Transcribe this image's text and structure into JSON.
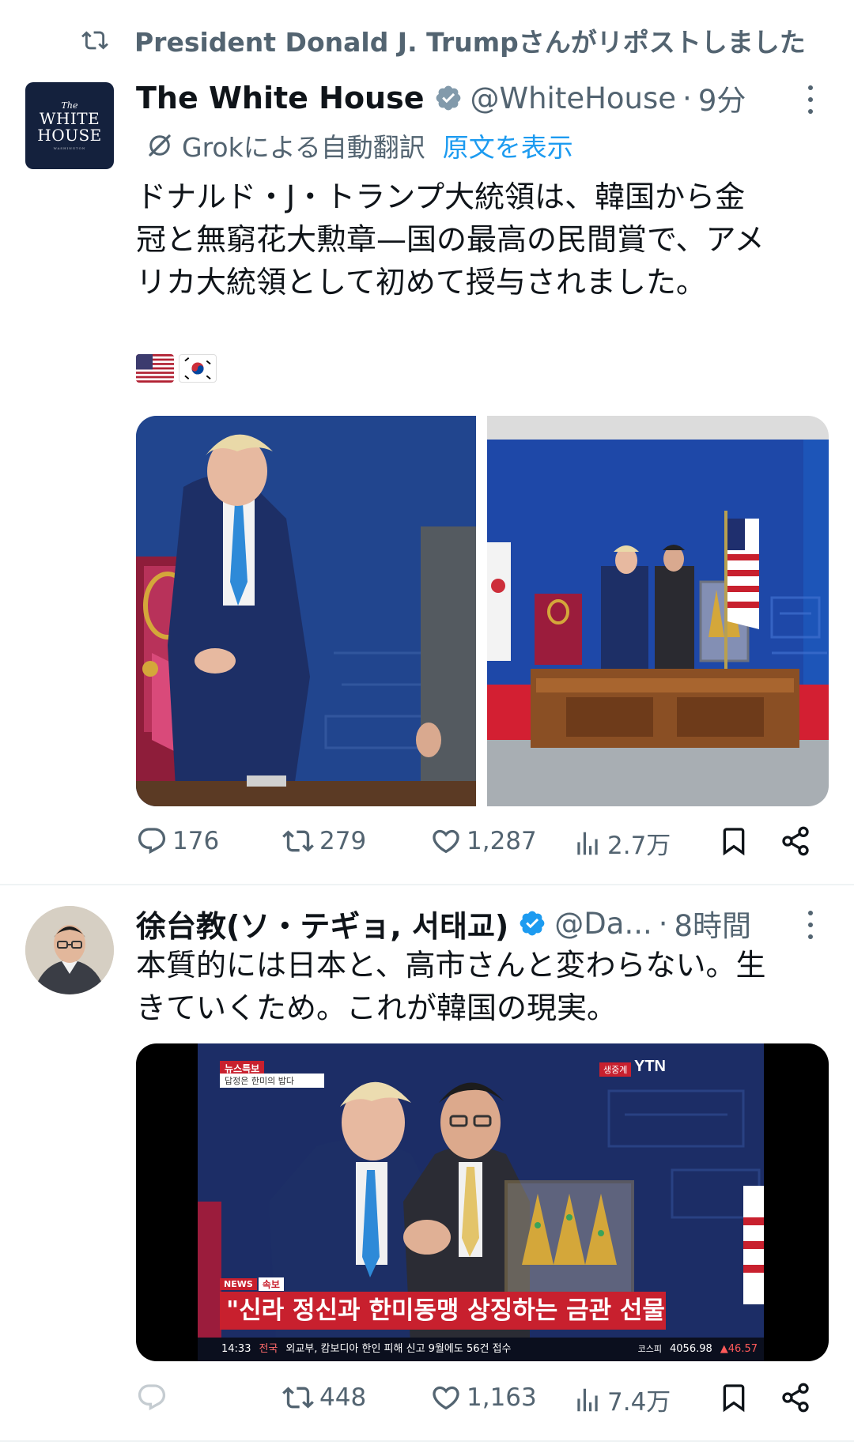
{
  "repost": {
    "icon": "repost-icon",
    "text": "President Donald J. Trumpさんがリポストしました"
  },
  "post1": {
    "avatar": {
      "lines": [
        "The",
        "WHITE",
        "HOUSE",
        "WASHINGTON"
      ]
    },
    "name": "The White House",
    "handle": "@WhiteHouse",
    "sep": "·",
    "time": "9分",
    "translate": {
      "label": "Grokによる自動翻訳",
      "link": "原文を表示"
    },
    "body_lines": [
      "ドナルド・J・トランプ大統領は、韓国から金",
      "冠と無窮花大勲章—国の最高の民間賞で、アメ",
      "リカ大統領として初めて授与されました。"
    ],
    "flags": [
      "us-flag",
      "kr-flag"
    ],
    "actions": {
      "replies": "176",
      "reposts": "279",
      "likes": "1,287",
      "views": "2.7万"
    }
  },
  "post2": {
    "name": "徐台教(ソ・テギョ, 서태교)",
    "handle": "@Da...",
    "sep": "·",
    "time": "8時間",
    "body_lines": [
      "本質的には日本と、高市さんと変わらない。生",
      "きていくため。これが韓国の現実。"
    ],
    "video": {
      "top_left_tag": "뉴스특보",
      "top_left_sub": "답정은 한미의 밥다",
      "live_label": "생중계",
      "channel": "YTN",
      "news_tag": "NEWS",
      "breaking": "속보",
      "headline": "\"신라 정신과 한미동맹 상징하는 금관 선물\"",
      "ticker_time": "14:33",
      "ticker_cat": "전국",
      "ticker_text": "외교부, 캄보디아 한인 피해 신고 9월에도 56건 접수",
      "index_label": "코스피",
      "index_value": "4056.98",
      "index_change": "▲46.57"
    },
    "actions": {
      "replies": "",
      "reposts": "448",
      "likes": "1,163",
      "views": "7.4万"
    }
  },
  "colors": {
    "accent": "#1d9bf0",
    "muted": "#536471",
    "text": "#0f1419",
    "divider": "#eff3f4"
  }
}
